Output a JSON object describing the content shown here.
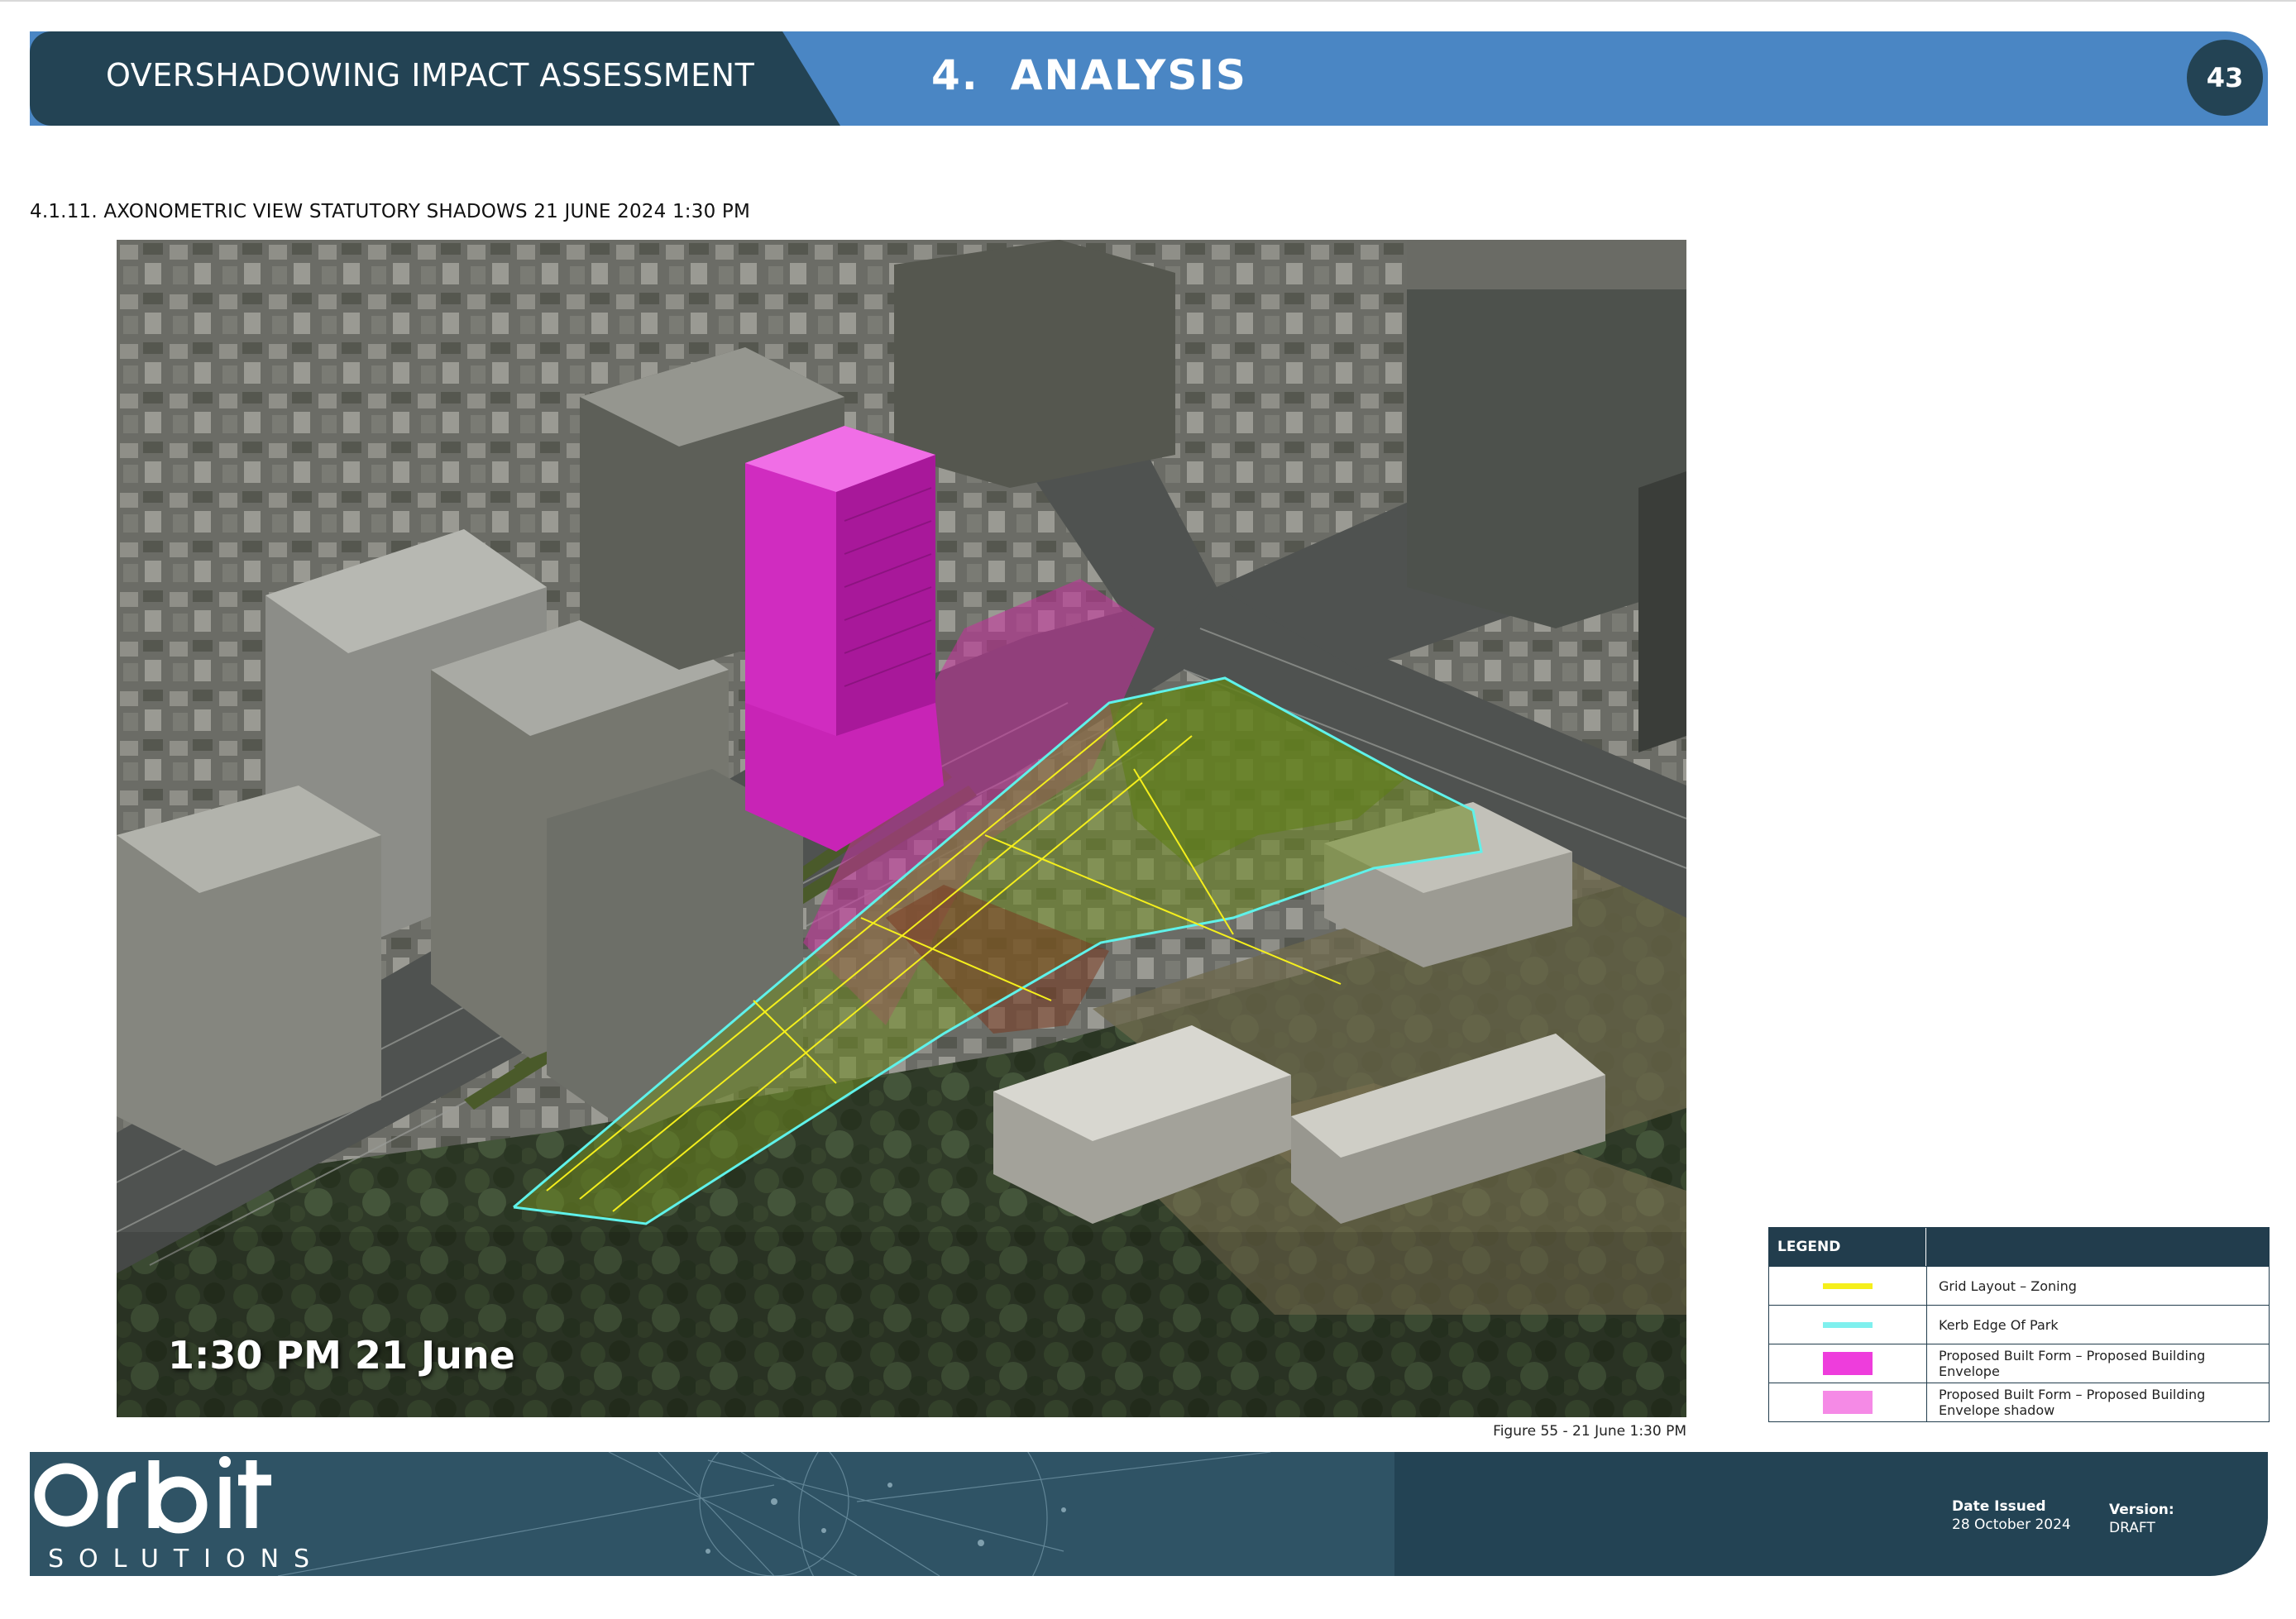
{
  "header": {
    "left_title": "OVERSHADOWING IMPACT ASSESSMENT",
    "section_number": "4.",
    "section_title": "ANALYSIS",
    "page_number": "43"
  },
  "section": {
    "title": "4.1.11. AXONOMETRIC VIEW STATUTORY SHADOWS 21 JUNE 2024 1:30 PM"
  },
  "figure": {
    "time_label": "1:30 PM 21 June",
    "caption": "Figure 55 - 21 June 1:30 PM"
  },
  "legend": {
    "heading": "LEGEND",
    "items": [
      {
        "label": "Grid Layout – Zoning",
        "color": "#f5ef1c",
        "kind": "line"
      },
      {
        "label": "Kerb Edge Of Park",
        "color": "#7ff0ee",
        "kind": "line"
      },
      {
        "label": "Proposed Built Form – Proposed Building Envelope",
        "color": "#ee3ddc",
        "kind": "box"
      },
      {
        "label": "Proposed Built Form – Proposed Building Envelope shadow",
        "color": "#f58ae6",
        "kind": "box"
      }
    ]
  },
  "footer": {
    "logo_text": "SOLUTIONS",
    "date_issued_label": "Date Issued",
    "date_issued_value": "28 October 2024",
    "version_label": "Version:",
    "version_value": "DRAFT"
  }
}
